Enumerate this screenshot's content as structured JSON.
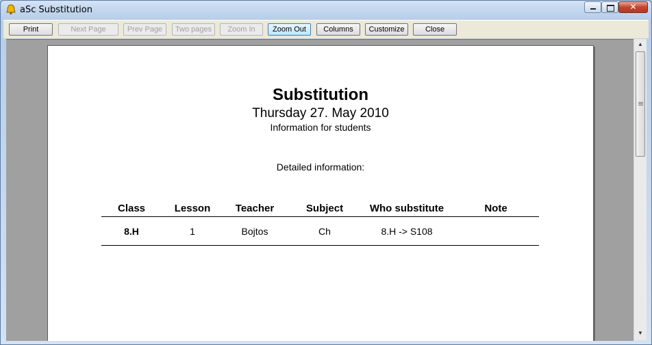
{
  "window": {
    "title": "aSc Substitution"
  },
  "toolbar": {
    "print": "Print",
    "next_page": "Next Page",
    "prev_page": "Prev Page",
    "two_pages": "Two pages",
    "zoom_in": "Zoom In",
    "zoom_out": "Zoom Out",
    "columns": "Columns",
    "customize": "Customize",
    "close": "Close"
  },
  "document": {
    "title": "Substitution",
    "date": "Thursday 27. May 2010",
    "subtitle": "Information for students",
    "section_label": "Detailed information:",
    "table": {
      "headers": [
        "Class",
        "Lesson",
        "Teacher",
        "Subject",
        "Who substitute",
        "Note"
      ],
      "rows": [
        [
          "8.H",
          "1",
          "Bojtos",
          "Ch",
          "8.H -> S108",
          ""
        ]
      ]
    }
  },
  "colors": {
    "title_bar": "#c2d6ee",
    "toolbar": "#ece9d8",
    "viewport": "#a0a0a0",
    "close_button": "#c4452c"
  }
}
